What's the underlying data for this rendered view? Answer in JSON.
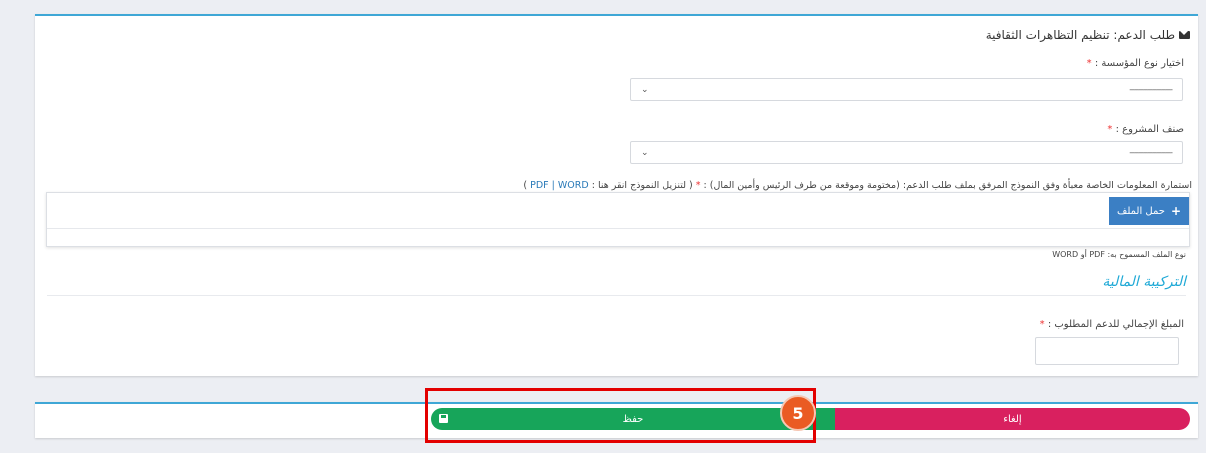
{
  "panel": {
    "title": "طلب الدعم: تنظيم التظاهرات الثقافية",
    "fields": {
      "org_type": {
        "label": "اختيار نوع المؤسسة :",
        "req": "*",
        "value": "-------------------"
      },
      "project_class": {
        "label": "صنف المشروع :",
        "req": "*",
        "value": "-------------------"
      },
      "form_file": {
        "label": "استمارة المعلومات الخاصة معبأة وفق النموذج المرفق بملف طلب الدعم: (مختومة وموقعة من طرف الرئيس وأمين المال) :",
        "req": "*",
        "download_prefix": "( لتنزيل النموذج انقر هنا :",
        "pdf_link": "PDF",
        "sep": "|",
        "word_link": "WORD",
        "download_suffix": ")",
        "upload_label": "حمل الملف",
        "allowed_types": "نوع الملف المسموح به: PDF أو WORD"
      }
    },
    "finance_section": "التركيبة المالية",
    "amount": {
      "label": "المبلغ الإجمالي للدعم المطلوب :",
      "req": "*",
      "value": ""
    }
  },
  "footer": {
    "save_label": "حفظ",
    "cancel_label": "إلغاء"
  },
  "annotation": {
    "step": "5"
  }
}
